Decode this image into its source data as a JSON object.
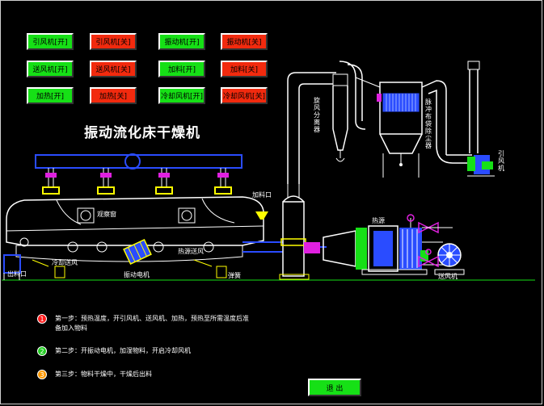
{
  "title": "振动流化床干燥机",
  "buttons": [
    {
      "label": "引风机[开]",
      "color": "green"
    },
    {
      "label": "引风机[关]",
      "color": "red"
    },
    {
      "label": "振动机[开]",
      "color": "green"
    },
    {
      "label": "振动机[关]",
      "color": "red"
    },
    {
      "label": "送风机[开]",
      "color": "green"
    },
    {
      "label": "送风机[关]",
      "color": "red"
    },
    {
      "label": "加料[开]",
      "color": "green"
    },
    {
      "label": "加料[关]",
      "color": "red"
    },
    {
      "label": "加热[开]",
      "color": "green"
    },
    {
      "label": "加热[关]",
      "color": "red"
    },
    {
      "label": "冷却风机[开]",
      "color": "green"
    },
    {
      "label": "冷却风机[关]",
      "color": "red"
    }
  ],
  "labels": {
    "observation_window": "观察窗",
    "feed_inlet": "加料口",
    "hot_air_in": "热源送风",
    "cool_air_in": "冷却送风",
    "outlet": "出料口",
    "vibration_motor": "振动电机",
    "spring": "弹簧",
    "heat_source": "热源",
    "blower": "送风机",
    "induced_fan": "引风机",
    "cyclone": "旋风分离器",
    "bag_filter": "脉冲布袋除尘器"
  },
  "steps": [
    {
      "num": "1",
      "color": "#ff1a1a",
      "text": "第一步：预热温度，开引风机、送风机、加热，预热至所需温度后准备加入物料"
    },
    {
      "num": "2",
      "color": "#22cc22",
      "text": "第二步：开振动电机，加湿物料，开启冷却风机"
    },
    {
      "num": "3",
      "color": "#ff9900",
      "text": "第三步：物料干燥中，干燥后出料"
    }
  ],
  "exit_label": "退 出"
}
